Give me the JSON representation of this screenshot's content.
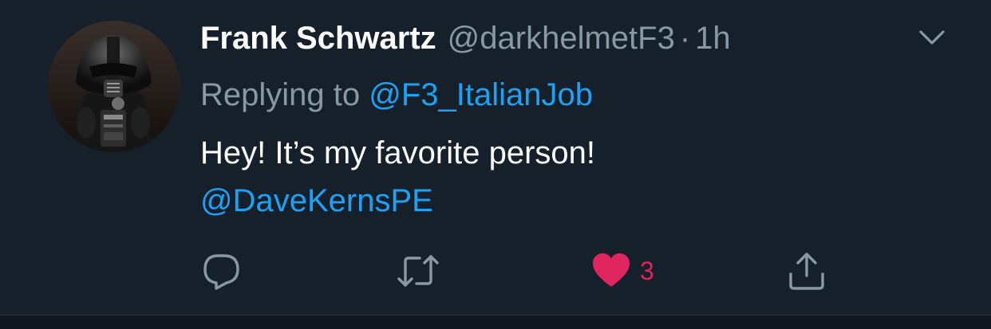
{
  "tweet": {
    "author_name": "Frank Schwartz",
    "author_handle": "@darkhelmetF3",
    "separator": "·",
    "timestamp": "1h",
    "replying_prefix": "Replying to",
    "replying_to": "@F3_ItalianJob",
    "text": "Hey! It’s my favorite person!",
    "mention": "@DaveKernsPE",
    "like_count": "3"
  },
  "icons": {
    "reply": "reply-icon",
    "retweet": "retweet-icon",
    "like": "heart-icon",
    "share": "share-icon",
    "menu": "chevron-down-icon"
  },
  "colors": {
    "background": "#15202b",
    "secondary_text": "#8899a6",
    "link": "#1da1f2",
    "like": "#e0245e"
  }
}
